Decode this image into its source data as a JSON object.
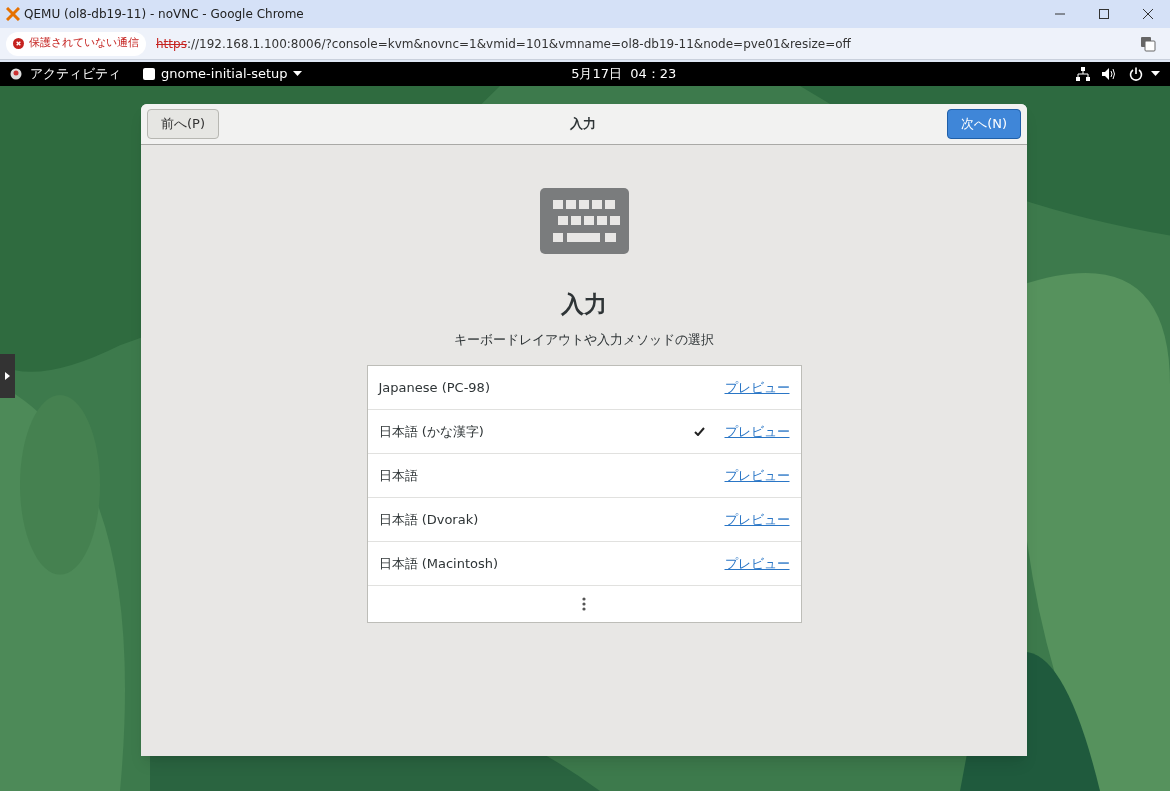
{
  "browser": {
    "title": "QEMU (ol8-db19-11) - noVNC - Google Chrome",
    "security_label": "保護されていない通信",
    "url_scheme": "https",
    "url_rest": "://192.168.1.100:8006/?console=kvm&novnc=1&vmid=101&vmname=ol8-db19-11&node=pve01&resize=off"
  },
  "top_bar": {
    "activities": "アクティビティ",
    "app_menu": "gnome-initial-setup",
    "clock": "5月17日  04：23"
  },
  "dialog": {
    "back_button": "前へ(P)",
    "title": "入力",
    "next_button": "次へ(N)",
    "heading": "入力",
    "subtitle": "キーボードレイアウトや入力メソッドの選択",
    "layouts": [
      {
        "name": "Japanese (PC-98)",
        "selected": false,
        "preview": "プレビュー"
      },
      {
        "name": "日本語 (かな漢字)",
        "selected": true,
        "preview": "プレビュー"
      },
      {
        "name": "日本語",
        "selected": false,
        "preview": "プレビュー"
      },
      {
        "name": "日本語 (Dvorak)",
        "selected": false,
        "preview": "プレビュー"
      },
      {
        "name": "日本語 (Macintosh)",
        "selected": false,
        "preview": "プレビュー"
      }
    ]
  }
}
